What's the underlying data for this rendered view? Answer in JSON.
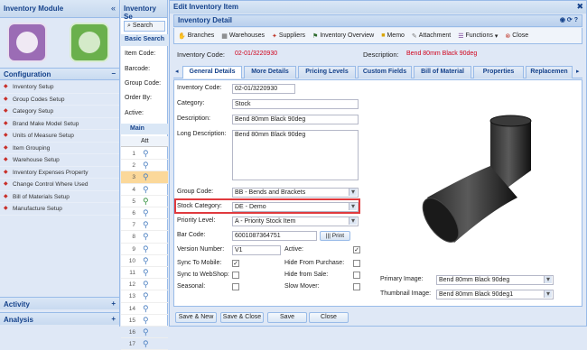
{
  "left": {
    "title": "Inventory Module",
    "config_label": "Configuration",
    "menu": [
      "Inventory Setup",
      "Group Codes Setup",
      "Category Setup",
      "Brand Make Model Setup",
      "Units of Measure Setup",
      "Item Grouping",
      "Warehouse Setup",
      "Inventory Expenses Property",
      "Change Control Where Used",
      "Bill of Materials Setup",
      "Manufacture Setup"
    ],
    "activity_label": "Activity",
    "analysis_label": "Analysis"
  },
  "mid": {
    "title": "Inventory Se",
    "search_label": "Search",
    "basic_search": "Basic Search",
    "fields": [
      "Item Code:",
      "Barcode:",
      "Group Code:",
      "Order By:",
      "Active:"
    ],
    "main_label": "Main",
    "att_label": "Att",
    "rows": [
      "1",
      "2",
      "3",
      "4",
      "5",
      "6",
      "7",
      "8",
      "9",
      "10",
      "11",
      "12",
      "13",
      "14",
      "15",
      "16",
      "17"
    ]
  },
  "dialog": {
    "title": "Edit Inventory Item",
    "detail_title": "Inventory Detail",
    "toolbar": [
      "Branches",
      "Warehouses",
      "Suppliers",
      "Inventory Overview",
      "Memo",
      "Attachment",
      "Functions",
      "Close"
    ],
    "code_label": "Inventory Code:",
    "code_value": "02-01/3220930",
    "desc_label": "Description:",
    "desc_value": "Bend 80mm Black 90deg",
    "tabs": [
      "General Details",
      "More Details",
      "Pricing Levels",
      "Custom Fields",
      "Bill of Material",
      "Properties",
      "Replacemen"
    ],
    "form": {
      "inv_code_label": "Inventory Code:",
      "inv_code": "02-01/3220930",
      "category_label": "Category:",
      "category": "Stock",
      "description_label": "Description:",
      "description": "Bend 80mm Black 90deg",
      "long_desc_label": "Long Description:",
      "long_desc": "Bend 80mm Black 90deg",
      "group_code_label": "Group Code:",
      "group_code": "BB - Bends and Brackets",
      "stock_cat_label": "Stock Category:",
      "stock_cat": "DE - Demo",
      "priority_label": "Priority Level:",
      "priority": "A - Priority Stock Item",
      "barcode_label": "Bar Code:",
      "barcode": "6001087364751",
      "print_label": "Print",
      "version_label": "Version Number:",
      "version": "V1",
      "active_label": "Active:",
      "sync_mobile_label": "Sync To Mobile:",
      "hide_purchase_label": "Hide From Purchase:",
      "sync_web_label": "Sync to WebShop:",
      "hide_sale_label": "Hide from Sale:",
      "seasonal_label": "Seasonal:",
      "slow_mover_label": "Slow Mover:",
      "primary_image_label": "Primary Image:",
      "primary_image": "Bend 80mm Black 90deg",
      "thumb_image_label": "Thumbnail Image:",
      "thumb_image": "Bend 80mm Black 90deg1"
    },
    "buttons": [
      "Save & New",
      "Save & Close",
      "Save",
      "Close"
    ]
  },
  "colors": {
    "highlight": "#e03a3e",
    "accent": "#15428b",
    "red_text": "#d0021b"
  }
}
